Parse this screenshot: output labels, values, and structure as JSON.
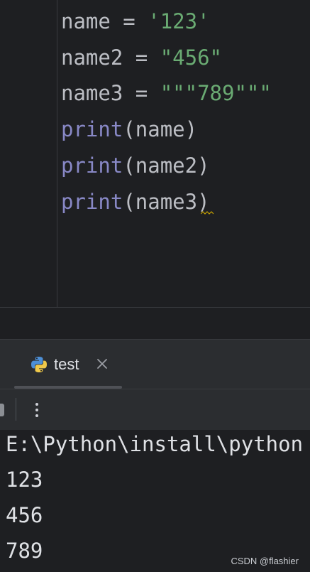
{
  "editor": {
    "lines": [
      {
        "name": "name",
        "op": " = ",
        "value": "'123'"
      },
      {
        "name": "name2",
        "op": " = ",
        "value": "\"456\""
      },
      {
        "name": "name3",
        "op": " = ",
        "value": "\"\"\"789\"\"\""
      },
      {
        "fn": "print",
        "open": "(",
        "arg": "name",
        "close": ")"
      },
      {
        "fn": "print",
        "open": "(",
        "arg": "name2",
        "close": ")"
      },
      {
        "fn": "print",
        "open": "(",
        "arg": "name3",
        "close": ")"
      }
    ]
  },
  "run": {
    "tab_label": "test",
    "tab_icon": "python-icon",
    "close_icon": "close-icon",
    "more_icon": "more-vertical-icon"
  },
  "console": {
    "lines": [
      "E:\\Python\\install\\python",
      "123",
      "456",
      "789"
    ]
  },
  "watermark": "CSDN @flashier",
  "colors": {
    "background": "#1e1f22",
    "panel": "#2b2d30",
    "string": "#6aab73",
    "builtin": "#8888c6",
    "text": "#bcbec4"
  }
}
